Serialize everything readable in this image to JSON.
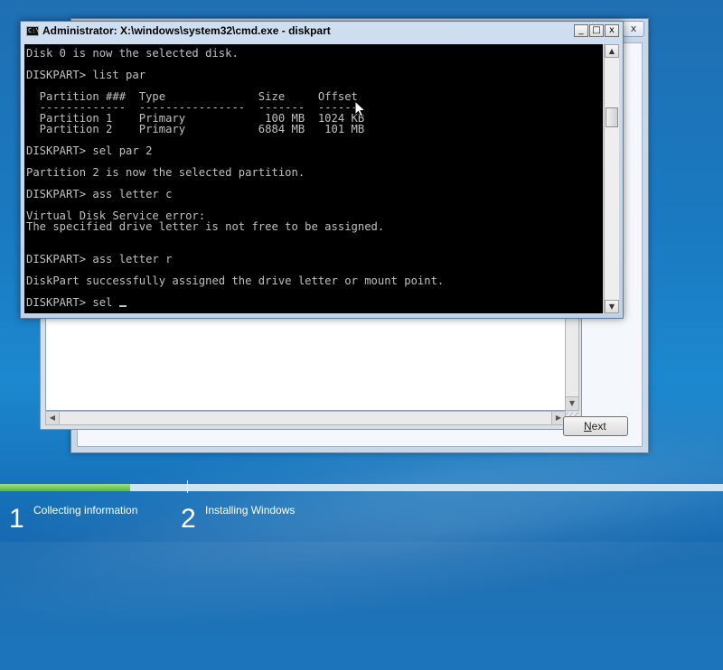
{
  "colors": {
    "accent": "#1a79c0",
    "progress": "#57b83b",
    "console_bg": "#000000",
    "console_text": "#c0c0c0"
  },
  "cmd": {
    "title": "Administrator: X:\\windows\\system32\\cmd.exe - diskpart",
    "icon": "cmd-icon",
    "buttons": {
      "minimize": "_",
      "maximize": "□",
      "close": "x"
    },
    "lines": [
      "Disk 0 is now the selected disk.",
      "",
      "DISKPART> list par",
      "",
      "  Partition ###  Type              Size     Offset",
      "  -------------  ----------------  -------  -------",
      "  Partition 1    Primary            100 MB  1024 KB",
      "  Partition 2    Primary           6884 MB   101 MB",
      "",
      "DISKPART> sel par 2",
      "",
      "Partition 2 is now the selected partition.",
      "",
      "DISKPART> ass letter c",
      "",
      "Virtual Disk Service error:",
      "The specified drive letter is not free to be assigned.",
      "",
      "",
      "DISKPART> ass letter r",
      "",
      "DiskPart successfully assigned the drive letter or mount point.",
      ""
    ],
    "current_input": "DISKPART> sel "
  },
  "setup": {
    "next_button_label": "Next",
    "next_button_mnemonic": "N",
    "next_button_rest": "ext",
    "close_glyph": "x"
  },
  "progress": {
    "fraction": 0.18,
    "steps": [
      {
        "number": "1",
        "label": "Collecting information"
      },
      {
        "number": "2",
        "label": "Installing Windows"
      }
    ]
  }
}
